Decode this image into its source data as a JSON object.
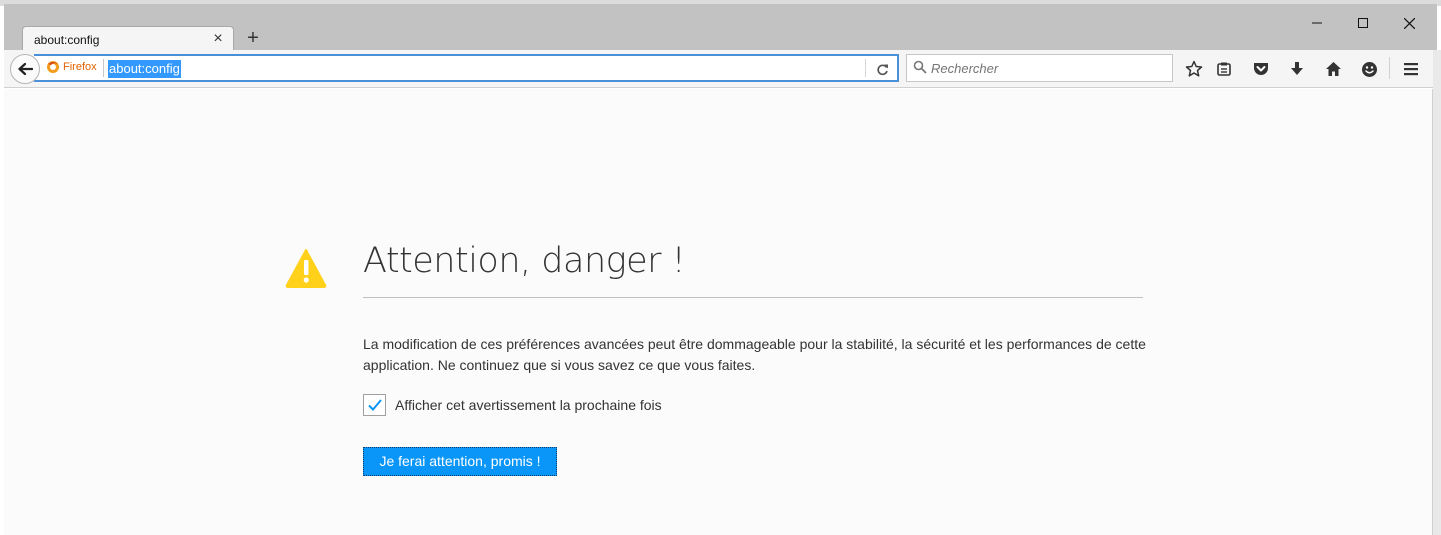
{
  "browser": {
    "tab": {
      "title": "about:config"
    },
    "identity_label": "Firefox",
    "url": "about:config",
    "search": {
      "placeholder": "Rechercher"
    }
  },
  "page": {
    "title": "Attention, danger !",
    "description": "La modification de ces préférences avancées peut être dommageable pour la stabilité, la sécurité et les performances de cette application. Ne continuez que si vous savez ce que vous faites.",
    "checkbox": {
      "label": "Afficher cet avertissement la prochaine fois",
      "checked": true
    },
    "accept_button": "Je ferai attention, promis !"
  },
  "icons": [
    "close-icon",
    "plus-icon",
    "minimize-icon",
    "maximize-icon",
    "back-icon",
    "firefox-icon",
    "reload-icon",
    "search-icon",
    "bookmark-star-icon",
    "reading-list-icon",
    "pocket-icon",
    "download-icon",
    "home-icon",
    "smiley-icon",
    "hamburger-menu-icon",
    "warning-icon",
    "checkmark-icon"
  ],
  "colors": {
    "accent": "#0996f8",
    "warning": "#ffd11a",
    "url_selection": "#3399ff",
    "firefox_orange": "#e66000"
  }
}
